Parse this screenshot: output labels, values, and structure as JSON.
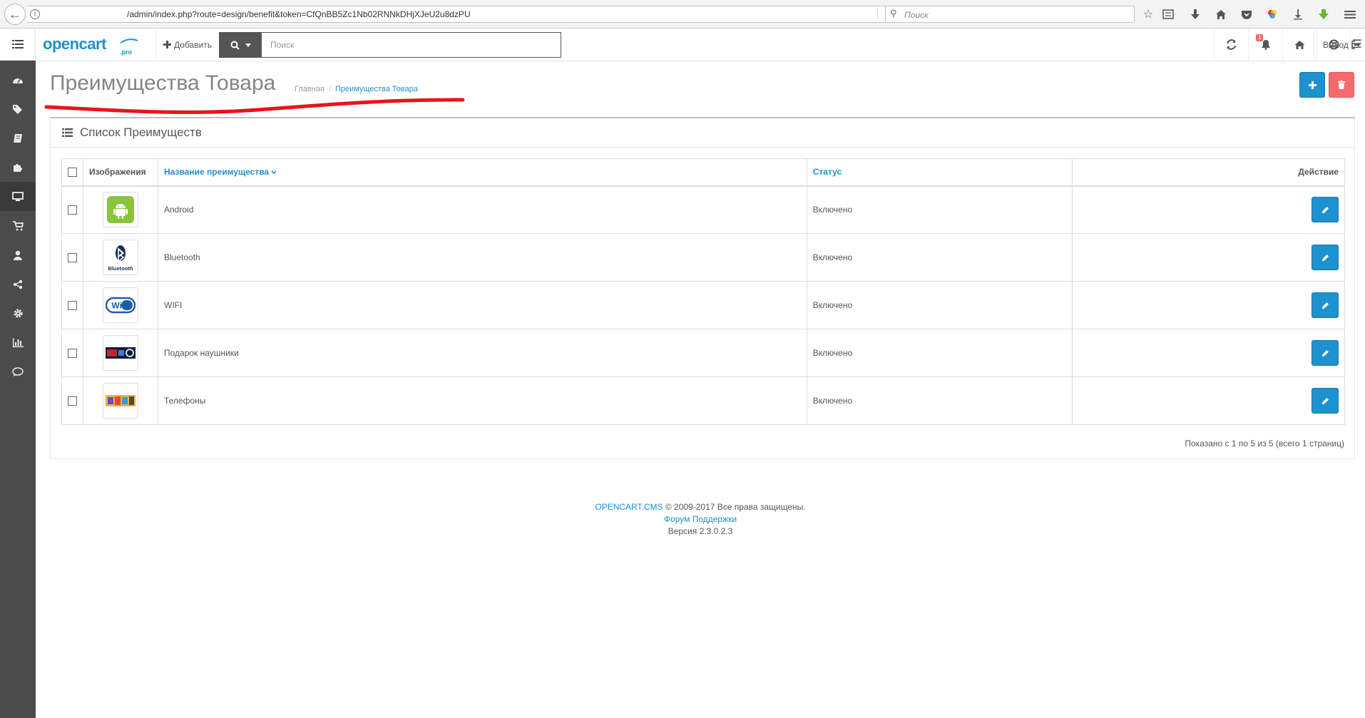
{
  "browser": {
    "url": "/admin/index.php?route=design/benefit&token=CfQnBB5Zc1Nb02RNNkDHjXJeU2u8dzPU",
    "search_placeholder": "Поиск"
  },
  "header": {
    "logo_text": "opencart",
    "logo_suffix": "pro",
    "add_label": "Добавить",
    "search_placeholder": "Поиск",
    "notification_count": "1",
    "logout_label": "Выход"
  },
  "page": {
    "title": "Преимущества Товара",
    "breadcrumb_home": "Главная",
    "breadcrumb_sep": "/",
    "breadcrumb_current": "Преимущества Товара"
  },
  "panel": {
    "title": "Список Преимуществ"
  },
  "table": {
    "columns": {
      "image": "Изображения",
      "name": "Название преимущества",
      "status": "Статус",
      "action": "Действие"
    },
    "rows": [
      {
        "name": "Android",
        "status": "Включено",
        "icon": "android"
      },
      {
        "name": "Bluetooth",
        "status": "Включено",
        "icon": "bluetooth",
        "icon_label": "Bluetooth"
      },
      {
        "name": "WIFI",
        "status": "Включено",
        "icon": "wifi",
        "icon_label": "WiFi"
      },
      {
        "name": "Подарок наушники",
        "status": "Включено",
        "icon": "headphones-gift"
      },
      {
        "name": "Телефоны",
        "status": "Включено",
        "icon": "phones"
      }
    ]
  },
  "pagination_text": "Показано с 1 по 5 из 5 (всего 1 страниц)",
  "footer": {
    "brand_link": "OPENCART.CMS",
    "copyright": "© 2009-2017 Все права защищены.",
    "forum_link": "Форум Поддержки",
    "version": "Версия 2.3.0.2.3"
  },
  "colors": {
    "primary": "#1e91cf",
    "danger": "#f56b6b",
    "sidebar": "#4b4b4b",
    "android_green": "#8ac33e"
  }
}
